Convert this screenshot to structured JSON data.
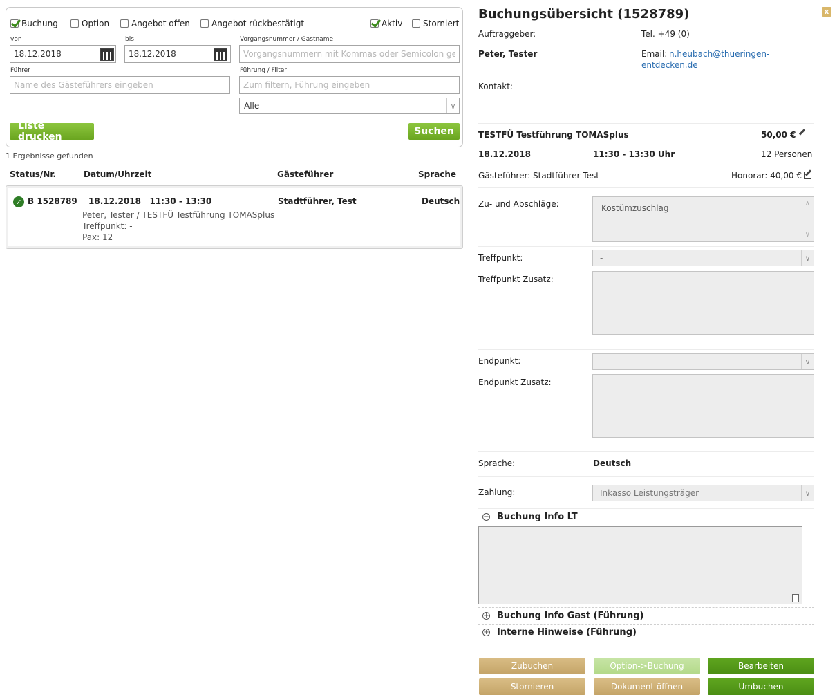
{
  "filters": {
    "checkboxes": [
      {
        "label": "Buchung",
        "checked": true
      },
      {
        "label": "Option",
        "checked": false
      },
      {
        "label": "Angebot offen",
        "checked": false
      },
      {
        "label": "Angebot rückbestätigt",
        "checked": false
      },
      {
        "label": "Aktiv",
        "checked": true
      },
      {
        "label": "Storniert",
        "checked": false
      }
    ],
    "von_label": "von",
    "von_value": "18.12.2018",
    "bis_label": "bis",
    "bis_value": "18.12.2018",
    "vorgang_label": "Vorgangsnummer / Gastname",
    "vorgang_placeholder": "Vorgangsnummern mit Kommas oder Semicolon getre",
    "fuehrer_label": "Führer",
    "fuehrer_placeholder": "Name des Gästeführers eingeben",
    "fuehrung_label": "Führung / Filter",
    "fuehrung_placeholder": "Zum filtern, Führung eingeben",
    "filter_select": "Alle",
    "print_button": "Liste drucken",
    "search_button": "Suchen"
  },
  "results": {
    "count_text": "1 Ergebnisse gefunden",
    "headers": [
      "Status/Nr.",
      "Datum/Uhrzeit",
      "Gästeführer",
      "Sprache"
    ],
    "rows": [
      {
        "number": "B 1528789",
        "datetime": "18.12.2018   11:30 - 13:30",
        "guide": "Stadtführer, Test",
        "language": "Deutsch",
        "line1": "Peter, Tester / TESTFÜ Testführung TOMASplus",
        "line2": "Treffpunkt: -",
        "line3": "Pax: 12"
      }
    ]
  },
  "detail": {
    "title": "Buchungsübersicht (1528789)",
    "close_label": "x",
    "auftraggeber_label": "Auftraggeber:",
    "tel": "Tel. +49 (0)",
    "client_name": "Peter, Tester",
    "email_label": "Email:",
    "email_line1": "n.heubach@thueringen-",
    "email_line2": "entdecken.de",
    "kontakt_label": "Kontakt:",
    "tour_name": "TESTFÜ Testführung TOMASplus",
    "price": "50,00 €",
    "date": "18.12.2018",
    "time": "11:30 - 13:30 Uhr",
    "persons": "12 Personen",
    "guide_line": "Gästeführer: Stadtführer Test",
    "honorar": "Honorar: 40,00 €",
    "zuschlaege_label": "Zu- und Abschläge:",
    "zuschlaege_value": "Kostümzuschlag",
    "treffpunkt_label": "Treffpunkt:",
    "treffpunkt_value": "-",
    "treffpunkt_zusatz_label": "Treffpunkt Zusatz:",
    "endpunkt_label": "Endpunkt:",
    "endpunkt_zusatz_label": "Endpunkt Zusatz:",
    "sprache_label": "Sprache:",
    "sprache_value": "Deutsch",
    "zahlung_label": "Zahlung:",
    "zahlung_value": "Inkasso Leistungsträger",
    "acc_info_lt": "Buchung Info LT",
    "acc_info_gast": "Buchung Info Gast (Führung)",
    "acc_interne": "Interne Hinweise (Führung)",
    "buttons": {
      "zubuchen": "Zubuchen",
      "option_buchung": "Option->Buchung",
      "bearbeiten": "Bearbeiten",
      "stornieren": "Stornieren",
      "dokument": "Dokument öffnen",
      "umbuchen": "Umbuchen"
    }
  }
}
